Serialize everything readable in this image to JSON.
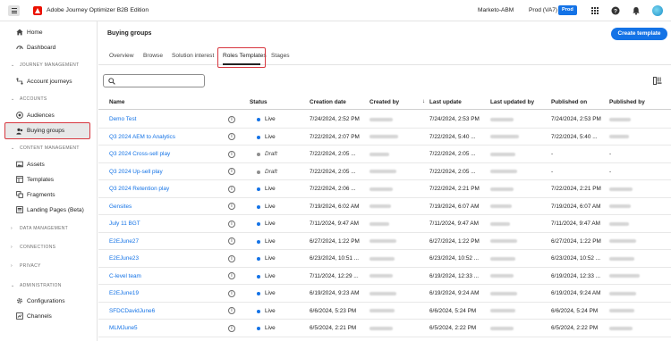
{
  "topbar": {
    "app_title": "Adobe Journey Optimizer B2B Edition",
    "org": "Marketo-ABM",
    "sandbox": "Prod (VA7)",
    "env_badge": "Prod"
  },
  "sidebar": {
    "items": [
      {
        "label": "Home",
        "icon": "home-icon"
      },
      {
        "label": "Dashboard",
        "icon": "dashboard-icon"
      }
    ],
    "sections": [
      {
        "title": "JOURNEY MANAGEMENT",
        "items": [
          {
            "label": "Account journeys",
            "icon": "journey-icon"
          }
        ]
      },
      {
        "title": "ACCOUNTS",
        "items": [
          {
            "label": "Audiences",
            "icon": "audiences-icon"
          },
          {
            "label": "Buying groups",
            "icon": "buying-groups-icon",
            "selected": true
          }
        ]
      },
      {
        "title": "CONTENT MANAGEMENT",
        "items": [
          {
            "label": "Assets",
            "icon": "assets-icon"
          },
          {
            "label": "Templates",
            "icon": "templates-icon"
          },
          {
            "label": "Fragments",
            "icon": "fragments-icon"
          },
          {
            "label": "Landing Pages (Beta)",
            "icon": "landing-pages-icon"
          }
        ]
      },
      {
        "title": "DATA MANAGEMENT",
        "items": []
      },
      {
        "title": "CONNECTIONS",
        "items": []
      },
      {
        "title": "PRIVACY",
        "items": []
      },
      {
        "title": "ADMINISTRATION",
        "items": [
          {
            "label": "Configurations",
            "icon": "configurations-icon"
          },
          {
            "label": "Channels",
            "icon": "channels-icon"
          }
        ]
      }
    ]
  },
  "main": {
    "page_title": "Buying groups",
    "create_button": "Create template",
    "tabs": [
      {
        "label": "Overview"
      },
      {
        "label": "Browse"
      },
      {
        "label": "Solution interest"
      },
      {
        "label": "Roles Templates",
        "active": true
      },
      {
        "label": "Stages"
      }
    ],
    "search_placeholder": ""
  },
  "table": {
    "columns": [
      "Name",
      "Status",
      "Creation date",
      "Created by",
      "Last update",
      "Last updated by",
      "Published on",
      "Published by"
    ],
    "sorted_column": "Last update",
    "rows": [
      {
        "name": "Demo Test",
        "status": "Live",
        "created": "7/24/2024, 2:52 PM",
        "updated": "7/24/2024, 2:53 PM",
        "published": "7/24/2024, 2:53 PM"
      },
      {
        "name": "Q3 2024 AEM to Analytics",
        "status": "Live",
        "created": "7/22/2024, 2:07 PM",
        "updated": "7/22/2024, 5:40 ...",
        "published": "7/22/2024, 5:40 ..."
      },
      {
        "name": "Q3 2024 Cross-sell play",
        "status": "Draft",
        "created": "7/22/2024, 2:05 ...",
        "updated": "7/22/2024, 2:05 ...",
        "published": "-"
      },
      {
        "name": "Q3 2024 Up-sell play",
        "status": "Draft",
        "created": "7/22/2024, 2:05 ...",
        "updated": "7/22/2024, 2:05 ...",
        "published": "-"
      },
      {
        "name": "Q3 2024 Retention play",
        "status": "Live",
        "created": "7/22/2024, 2:06 ...",
        "updated": "7/22/2024, 2:21 PM",
        "published": "7/22/2024, 2:21 PM"
      },
      {
        "name": "Gensites",
        "status": "Live",
        "created": "7/19/2024, 6:02 AM",
        "updated": "7/19/2024, 6:07 AM",
        "published": "7/19/2024, 6:07 AM"
      },
      {
        "name": "July 11 BGT",
        "status": "Live",
        "created": "7/11/2024, 9:47 AM",
        "updated": "7/11/2024, 9:47 AM",
        "published": "7/11/2024, 9:47 AM"
      },
      {
        "name": "E2EJune27",
        "status": "Live",
        "created": "6/27/2024, 1:22 PM",
        "updated": "6/27/2024, 1:22 PM",
        "published": "6/27/2024, 1:22 PM"
      },
      {
        "name": "E2EJune23",
        "status": "Live",
        "created": "6/23/2024, 10:51 ...",
        "updated": "6/23/2024, 10:52 ...",
        "published": "6/23/2024, 10:52 ..."
      },
      {
        "name": "C-level team",
        "status": "Live",
        "created": "7/11/2024, 12:29 ...",
        "updated": "6/19/2024, 12:33 ...",
        "published": "6/19/2024, 12:33 ..."
      },
      {
        "name": "E2EJune19",
        "status": "Live",
        "created": "6/19/2024, 9:23 AM",
        "updated": "6/19/2024, 9:24 AM",
        "published": "6/19/2024, 9:24 AM"
      },
      {
        "name": "SFDCDavidJune6",
        "status": "Live",
        "created": "6/6/2024, 5:23 PM",
        "updated": "6/6/2024, 5:24 PM",
        "published": "6/6/2024, 5:24 PM"
      },
      {
        "name": "MLMJune5",
        "status": "Live",
        "created": "6/5/2024, 2:21 PM",
        "updated": "6/5/2024, 2:22 PM",
        "published": "6/5/2024, 2:22 PM"
      }
    ]
  },
  "colors": {
    "accent": "#1473e6",
    "highlight": "#d7373f",
    "live_dot": "#1473e6",
    "draft_dot": "#8e8e8e"
  }
}
